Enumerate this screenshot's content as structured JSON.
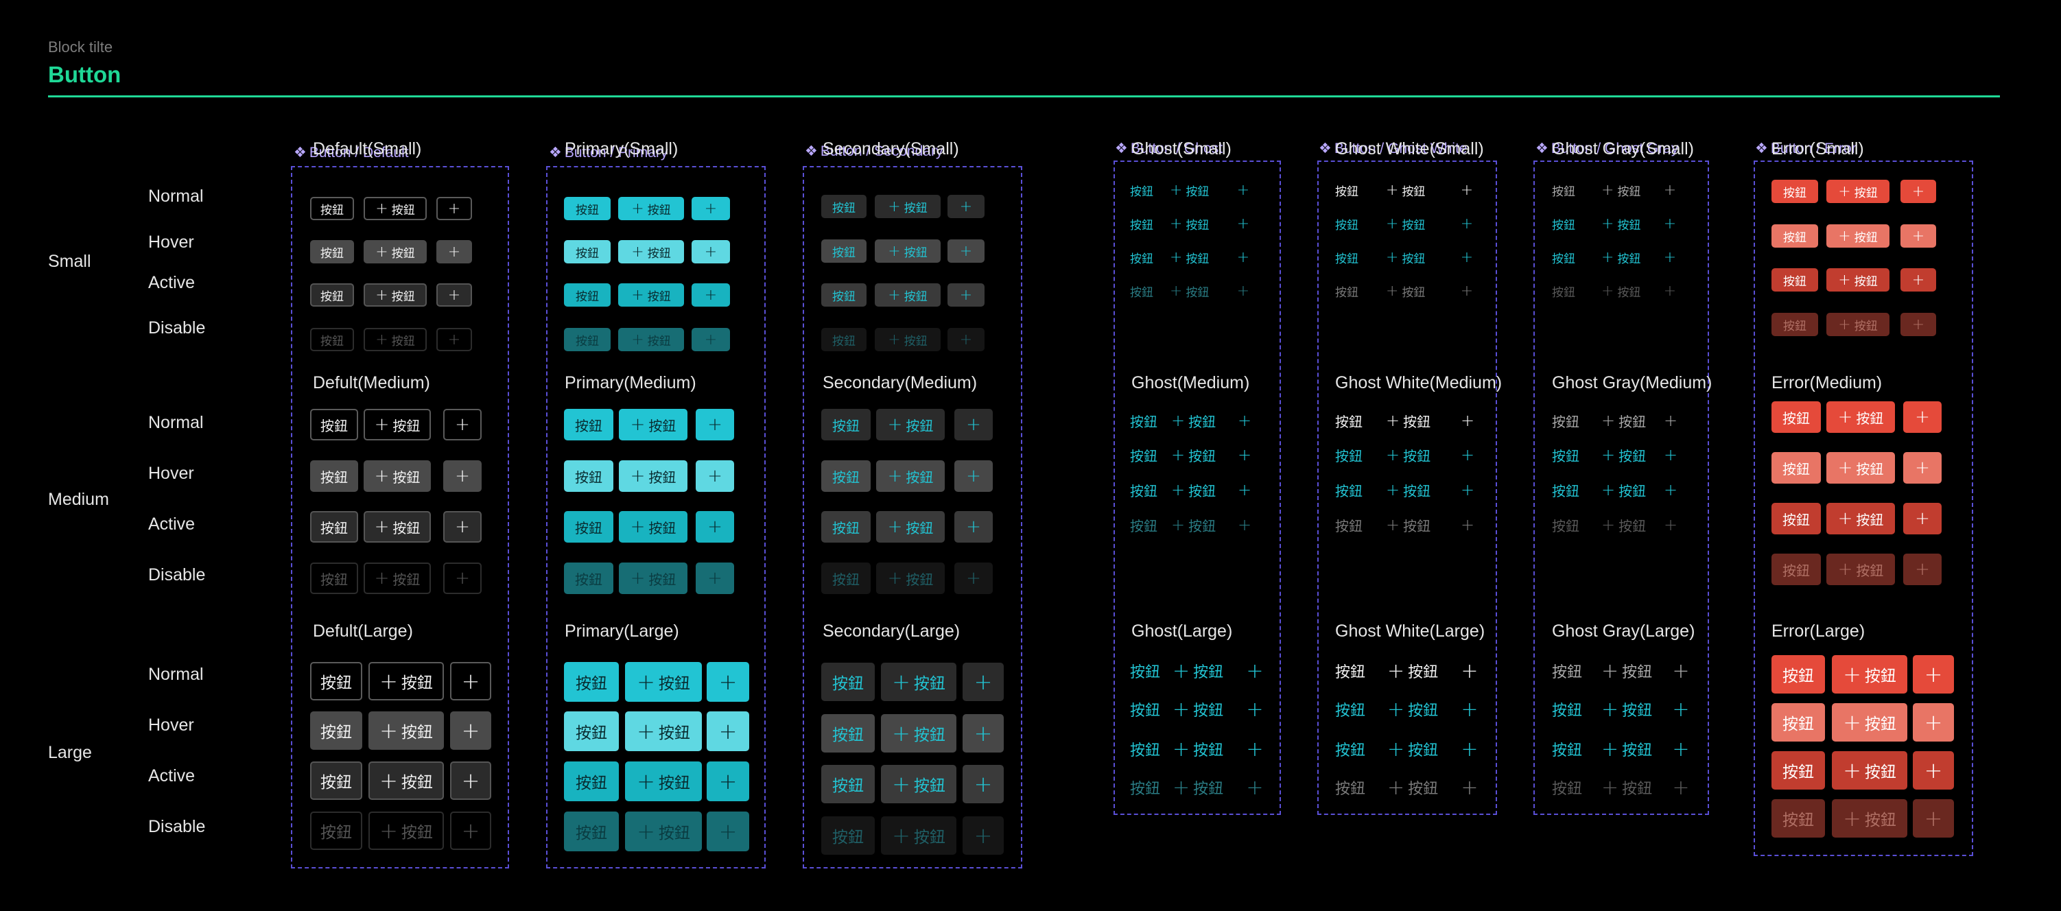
{
  "block": {
    "label": "Block tilte",
    "title": "Button"
  },
  "sizes": [
    "Small",
    "Medium",
    "Large"
  ],
  "states": [
    "Normal",
    "Hover",
    "Active",
    "Disable"
  ],
  "button_label": "按鈕",
  "plus_glyph": "+",
  "columns": [
    {
      "component": "Button / Default",
      "headings": [
        "Default(Small)",
        "Defult(Medium)",
        "Defult(Large)"
      ]
    },
    {
      "component": "Button / Primary",
      "headings": [
        "Primary(Small)",
        "Primary(Medium)",
        "Primary(Large)"
      ]
    },
    {
      "component": "Button / Secondary",
      "headings": [
        "Secondary(Small)",
        "Secondary(Medium)",
        "Secondary(Large)"
      ]
    },
    {
      "component": "Button / Ghost",
      "headings": [
        "Ghost(Small)",
        "Ghost(Medium)",
        "Ghost(Large)"
      ]
    },
    {
      "component": "Button / Ghost White",
      "headings": [
        "Ghost White(Small)",
        "Ghost White(Medium)",
        "Ghost White(Large)"
      ]
    },
    {
      "component": "Button / Ghost Gray",
      "headings": [
        "Ghost Gray(Small)",
        "Ghost Gray(Medium)",
        "Ghost Gray(Large)"
      ]
    },
    {
      "component": "Button / Error",
      "headings": [
        "Error(Small)",
        "Error(Medium)",
        "Error(Large)"
      ]
    }
  ],
  "colors": {
    "accent": "#1fd896",
    "frame": "#5a4fd6",
    "component_name": "#b9a8ff",
    "primary": "#22c4d3",
    "primary_hover": "#5fd8e2",
    "primary_active": "#18b3c0",
    "primary_disable": "#176d74",
    "ghost_text": "#22c4d3",
    "error": "#e54a3a",
    "error_hover": "#e87565",
    "error_active": "#c13d2f",
    "error_disable": "#6a2820"
  }
}
